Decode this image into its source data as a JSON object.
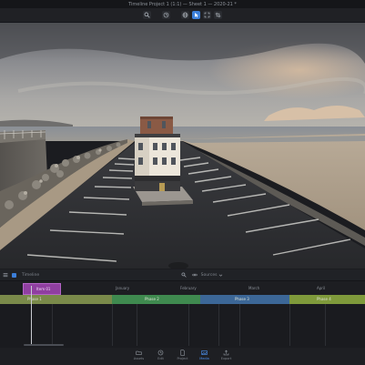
{
  "window": {
    "title": "Timeline Project 1 (1:1) — Sheet 1 — 2020-21 *"
  },
  "toolbar": {
    "buttons": [
      {
        "icon": "search-icon"
      },
      {
        "icon": "history-icon"
      },
      {
        "icon": "globe-icon"
      },
      {
        "icon": "pointer-icon",
        "active": true
      },
      {
        "icon": "expand-icon"
      },
      {
        "icon": "crop-icon"
      }
    ]
  },
  "timeline_toolbar": {
    "left_label": "Timeline",
    "right_label": "Sources"
  },
  "ruler": {
    "labels": [
      "January",
      "February",
      "March",
      "April"
    ]
  },
  "clip": {
    "label": "Item 01"
  },
  "tracks": [
    {
      "label": "Phase 1",
      "color": "#7a8a4a"
    },
    {
      "label": "Phase 2",
      "color": "#3f8a4f"
    },
    {
      "label": "Phase 3",
      "color": "#3c6797"
    },
    {
      "label": "Phase 4",
      "color": "#7f9a3b"
    }
  ],
  "bottom_bar": {
    "items": [
      {
        "label": "Assets",
        "icon": "folder-icon"
      },
      {
        "label": "Edit",
        "icon": "clock-icon"
      },
      {
        "label": "Project",
        "icon": "document-icon"
      },
      {
        "label": "Media",
        "icon": "image-icon",
        "active": true
      },
      {
        "label": "Export",
        "icon": "export-icon"
      }
    ]
  },
  "colors": {
    "accent": "#3c7fd9",
    "clip": "#8f3fa0",
    "background": "#1b1c20"
  }
}
